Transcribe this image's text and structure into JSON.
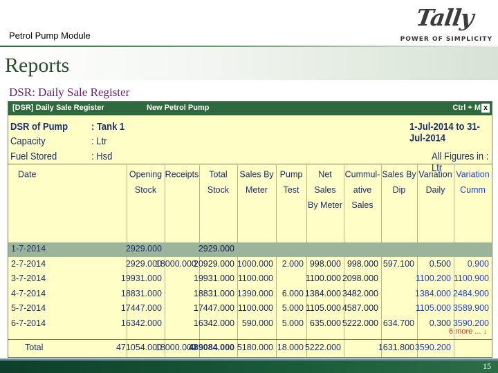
{
  "slide": {
    "module_title": "Petrol Pump Module",
    "logo_word": "Tally",
    "logo_tagline": "POWER OF SIMPLICITY",
    "section_title": "Reports",
    "subtitle": "DSR: Daily Sale Register",
    "page_number": "15"
  },
  "window": {
    "title_left": "[DSR] Daily Sale Register",
    "title_center": "New Petrol Pump",
    "title_right": "Ctrl + M",
    "close_label": "x"
  },
  "info": {
    "dsr_label": "DSR of Pump",
    "dsr_value": ": Tank 1",
    "capacity_label": "Capacity",
    "capacity_value": ": Ltr",
    "fuel_label": "Fuel Stored",
    "fuel_value": ": Hsd",
    "period": "1-Jul-2014 to 31-Jul-2014",
    "figures_in": "All Figures in :  Ltr"
  },
  "columns": [
    {
      "line1": "Date",
      "line2": "",
      "line3": ""
    },
    {
      "line1": "Opening",
      "line2": "Stock",
      "line3": ""
    },
    {
      "line1": "Receipts",
      "line2": "",
      "line3": ""
    },
    {
      "line1": "Total",
      "line2": "Stock",
      "line3": ""
    },
    {
      "line1": "Sales By",
      "line2": "Meter",
      "line3": ""
    },
    {
      "line1": "Pump",
      "line2": "Test",
      "line3": ""
    },
    {
      "line1": "Net Sales",
      "line2": "By Meter",
      "line3": ""
    },
    {
      "line1": "Cummul-",
      "line2": "ative",
      "line3": "Sales"
    },
    {
      "line1": "Sales By",
      "line2": "Dip",
      "line3": ""
    },
    {
      "line1": "Variation",
      "line2": "Daily",
      "line3": ""
    },
    {
      "line1": "Variation",
      "line2": "Cumm",
      "line3": ""
    }
  ],
  "rows": [
    [
      "1-7-2014",
      "2929.000",
      "",
      "2929.000",
      "",
      "",
      "",
      "",
      "",
      "",
      ""
    ],
    [
      "2-7-2014",
      "2929.000",
      "18000.000",
      "20929.000",
      "1000.000",
      "2.000",
      "998.000",
      "998.000",
      "597.100",
      "0.500",
      "0.900"
    ],
    [
      "3-7-2014",
      "19931.000",
      "",
      "19931.000",
      "1100.000",
      "",
      "1100.000",
      "2098.000",
      "",
      "1100.200",
      "1100.900"
    ],
    [
      "4-7-2014",
      "18831.000",
      "",
      "18831.000",
      "1390.000",
      "6.000",
      "1384.000",
      "3482.000",
      "",
      "1384.000",
      "2484.900"
    ],
    [
      "5-7-2014",
      "17447.000",
      "",
      "17447.000",
      "1100.000",
      "5.000",
      "1105.000",
      "4587.000",
      "",
      "1105.000",
      "3589.900"
    ],
    [
      "6-7-2014",
      "16342.000",
      "",
      "16342.000",
      "590.000",
      "5.000",
      "635.000",
      "5222.000",
      "634.700",
      "0.300",
      "3590.200"
    ]
  ],
  "more_label": "6 more ... ↓",
  "totals": [
    "Total",
    "471054.000",
    "18000.000",
    "489084.000",
    "5180.000",
    "18.000",
    "5222.000",
    "",
    "1631.800",
    "3590.200",
    ""
  ]
}
